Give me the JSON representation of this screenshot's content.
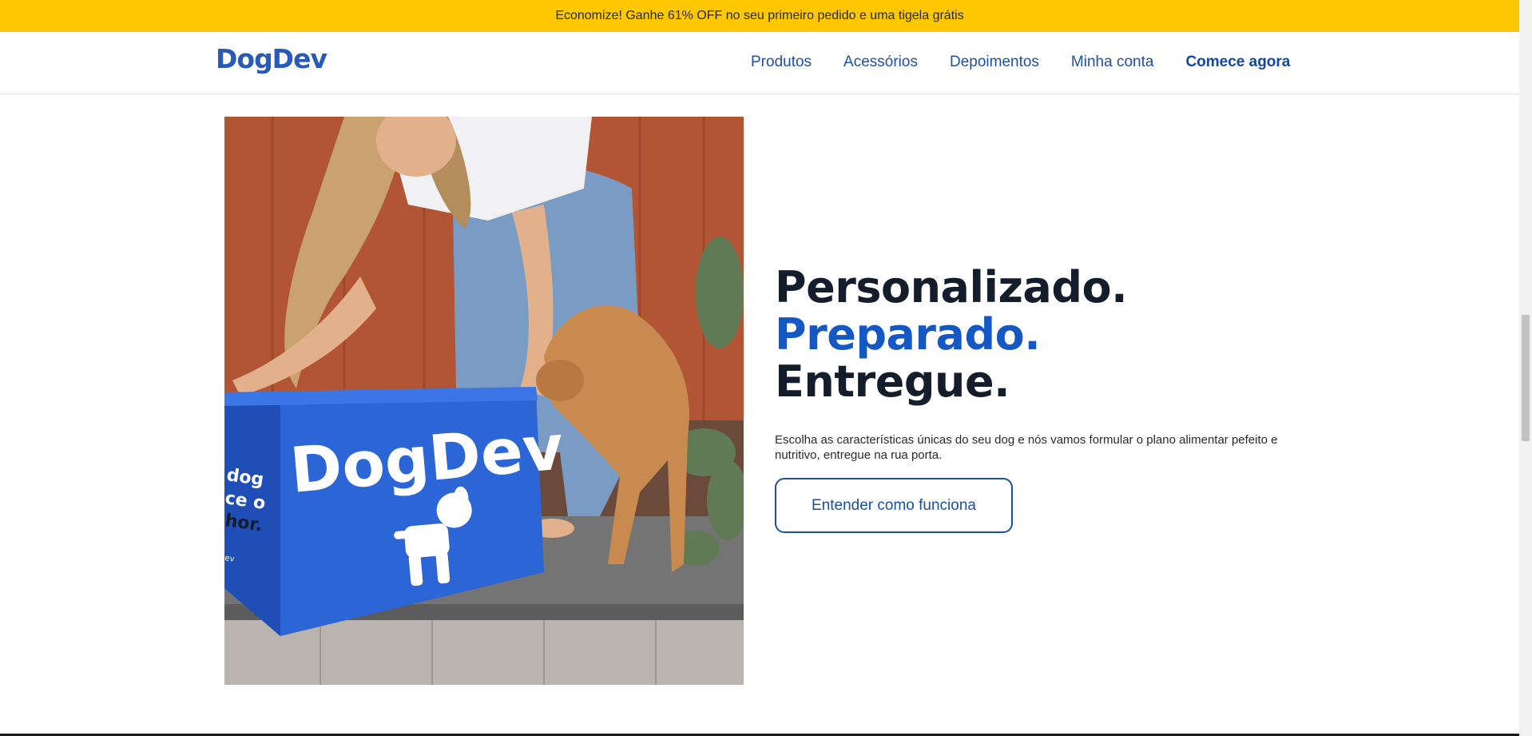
{
  "promo": {
    "text": "Economize! Ganhe 61% OFF no seu primeiro pedido e uma tigela grátis"
  },
  "header": {
    "logo": "DogDev",
    "nav": [
      {
        "label": "Produtos"
      },
      {
        "label": "Acessórios"
      },
      {
        "label": "Depoimentos"
      },
      {
        "label": "Minha conta"
      },
      {
        "label": "Comece agora"
      }
    ]
  },
  "hero": {
    "image": {
      "box_brand": "DogDev",
      "box_side_text": [
        "dog",
        "ce o",
        "hor."
      ],
      "box_side_small": "ev",
      "colors": {
        "wall": "#b25534",
        "box": "#2b65d6",
        "dog": "#c98a4f",
        "jeans": "#7a9bc4"
      }
    },
    "title_line1": "Personalizado.",
    "title_line2": "Preparado.",
    "title_line3": "Entregue.",
    "description": "Escolha as características únicas do seu dog e nós vamos formular o plano alimentar pefeito e nutritivo, entregue na rua porta.",
    "button": "Entender como funciona"
  },
  "colors": {
    "promo_bg": "#ffc700",
    "brand_blue": "#1558c4",
    "text_dark": "#141d2b"
  }
}
